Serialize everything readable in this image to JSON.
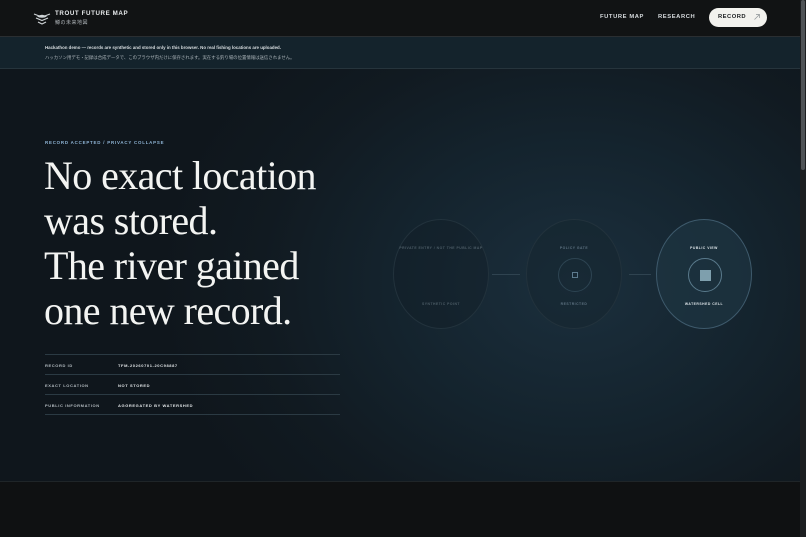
{
  "brand": {
    "title": "TROUT FUTURE MAP",
    "subtitle": "鱒の未来地図",
    "logo_icon": "trout-emblem-icon"
  },
  "nav": {
    "links": [
      "FUTURE MAP",
      "RESEARCH"
    ],
    "record_button": "RECORD",
    "record_icon": "arrow-up-right-icon"
  },
  "notice": {
    "en": "Hackathon demo — records are synthetic and stored only in this browser. No real fishing locations are uploaded.",
    "ja": "ハッカソン用デモ・記録は合成データで、このブラウザ内だけに保存されます。実在する釣り場の位置情報は送信されません。"
  },
  "hero": {
    "eyebrow": "RECORD ACCEPTED / PRIVACY COLLAPSE",
    "headline_lines": [
      "No exact location",
      "was stored.",
      "The river gained",
      "one new record."
    ],
    "meta": [
      {
        "key": "RECORD ID",
        "value": "TFM-20260701-20C98887"
      },
      {
        "key": "EXACT LOCATION",
        "value": "NOT STORED"
      },
      {
        "key": "PUBLIC INFORMATION",
        "value": "AGGREGATED BY WATERSHED"
      }
    ]
  },
  "diagram": {
    "nodes": [
      {
        "top": "PRIVATE ENTRY / NOT THE PUBLIC MAP",
        "bottom": "SYNTHETIC POINT"
      },
      {
        "top": "POLICY GATE",
        "bottom": "RESTRICTED"
      },
      {
        "top": "PUBLIC VIEW",
        "bottom": "WATERSHED CELL"
      }
    ]
  },
  "colors": {
    "accent": "#8fb5d6",
    "background": "#0f1112",
    "hero_glow": "#1b2f3d",
    "button_bg": "#f2f2ee"
  }
}
